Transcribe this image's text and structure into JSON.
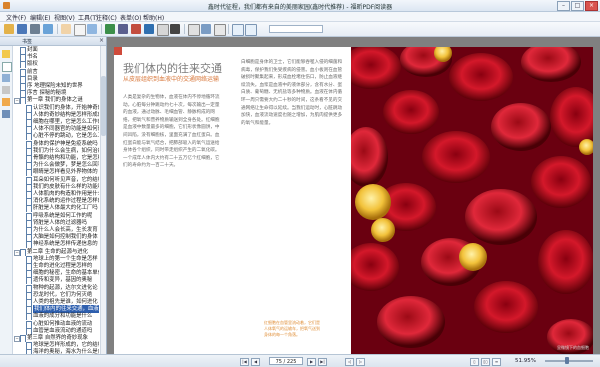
{
  "window": {
    "title": "鑫时代征程，我们都有来自的美丽家园(鑫时代推荐) - 福昕PDF阅读器",
    "minimize": "–",
    "maximize": "□",
    "close": "×"
  },
  "menu": [
    "文件(F)",
    "编辑(E)",
    "视图(V)",
    "工具(T)",
    "注释(C)",
    "表单(O)",
    "帮助(H)"
  ],
  "toolbar": {
    "search_placeholder": "",
    "icons": [
      "open-icon",
      "save-icon",
      "print-icon",
      "email-icon",
      "hand-icon",
      "select-icon",
      "zoom-icon",
      "snapshot-icon",
      "rotate-icon",
      "fit-page-icon",
      "fit-width-icon",
      "prev-view-icon",
      "next-view-icon",
      "bookmark-icon",
      "comment-icon"
    ]
  },
  "sidebar": {
    "header": "书签",
    "close": "×",
    "tabs": [
      "bookmarks-tab-icon",
      "pages-tab-icon",
      "layers-tab-icon",
      "attach-tab-icon",
      "comments-tab-icon",
      "sign-tab-icon"
    ],
    "items": [
      {
        "label": "封面",
        "level": 1,
        "expander": ""
      },
      {
        "label": "书名",
        "level": 1,
        "expander": ""
      },
      {
        "label": "版权",
        "level": 1,
        "expander": ""
      },
      {
        "label": "前言",
        "level": 1,
        "expander": ""
      },
      {
        "label": "目录",
        "level": 1,
        "expander": ""
      },
      {
        "label": "序 地理探险未知的世界",
        "level": 1,
        "expander": ""
      },
      {
        "label": "序言 探秘的秘境",
        "level": 1,
        "expander": ""
      },
      {
        "label": "第一章 我们的身体之谜",
        "level": 1,
        "expander": "−"
      },
      {
        "label": "认识我们的身体，开始神奇的旅程",
        "level": 2,
        "expander": ""
      },
      {
        "label": "人体的奇妙结构是怎样形成的",
        "level": 2,
        "expander": ""
      },
      {
        "label": "细胞在哪里，它是怎么工作的呢",
        "level": 2,
        "expander": ""
      },
      {
        "label": "人体不同器官的功能是如何形成的",
        "level": 2,
        "expander": ""
      },
      {
        "label": "心脏不停的跳动，它是怎么工作的",
        "level": 2,
        "expander": ""
      },
      {
        "label": "身体的保护神是免疫系统吗",
        "level": 2,
        "expander": ""
      },
      {
        "label": "我们为什么会生病，如何治疗",
        "level": 2,
        "expander": ""
      },
      {
        "label": "骨骼的结构和功能，它是怎样的",
        "level": 2,
        "expander": ""
      },
      {
        "label": "为什么会做梦，梦是怎么回事",
        "level": 2,
        "expander": ""
      },
      {
        "label": "眼睛是怎样看见外界物体的",
        "level": 2,
        "expander": ""
      },
      {
        "label": "耳朵如何听见声音，它的结构",
        "level": 2,
        "expander": ""
      },
      {
        "label": "我们的皮肤有什么样的功能呢",
        "level": 2,
        "expander": ""
      },
      {
        "label": "人体肌肉的构造和作用是什么",
        "level": 2,
        "expander": ""
      },
      {
        "label": "消化系统的运作过程是怎样的",
        "level": 2,
        "expander": ""
      },
      {
        "label": "肝脏是人体最大的化工厂吗",
        "level": 2,
        "expander": ""
      },
      {
        "label": "呼吸系统是如何工作的呢",
        "level": 2,
        "expander": ""
      },
      {
        "label": "肾脏是人体的过滤器吗",
        "level": 2,
        "expander": ""
      },
      {
        "label": "为什么人会长高，生长发育",
        "level": 2,
        "expander": ""
      },
      {
        "label": "大脑是如何控制我们的身体",
        "level": 2,
        "expander": ""
      },
      {
        "label": "神经系统是怎样传递信息的",
        "level": 2,
        "expander": ""
      },
      {
        "label": "第二章 生命的起源与进化",
        "level": 1,
        "expander": "−"
      },
      {
        "label": "地球上的第一个生命是怎样",
        "level": 2,
        "expander": ""
      },
      {
        "label": "生命的进化过程是怎样的",
        "level": 2,
        "expander": ""
      },
      {
        "label": "细胞的秘密，生命的基本单位",
        "level": 2,
        "expander": ""
      },
      {
        "label": "遗传和变异，基因的奥秘",
        "level": 2,
        "expander": ""
      },
      {
        "label": "物种的起源，达尔文进化论",
        "level": 2,
        "expander": ""
      },
      {
        "label": "恐龙时代，它们为何灭绝",
        "level": 2,
        "expander": ""
      },
      {
        "label": "人类的祖先是谁，如何进化",
        "level": 2,
        "expander": ""
      },
      {
        "label": "我们体内的往来交通，血液循环",
        "level": 2,
        "expander": "",
        "selected": true
      },
      {
        "label": "血液的成分和功能是什么",
        "level": 2,
        "expander": ""
      },
      {
        "label": "心脏如何推动血液的流动",
        "level": 2,
        "expander": ""
      },
      {
        "label": "血管是血液流动的通道吗",
        "level": 2,
        "expander": ""
      },
      {
        "label": "第三章 自然界的奇妙现象",
        "level": 1,
        "expander": "−"
      },
      {
        "label": "地球是怎样形成的，它的结构",
        "level": 2,
        "expander": ""
      },
      {
        "label": "海洋的奥秘，海水为什么是咸的",
        "level": 2,
        "expander": ""
      },
      {
        "label": "地震火山是怎么形成的",
        "level": 2,
        "expander": ""
      }
    ]
  },
  "document": {
    "title": "我们体内的往来交通",
    "subtitle": "从皮层组织到血液中的交通网络运输",
    "col1": "人类是复杂的生物体，血液在体内不停地循环流动。心脏每分钟跳动约七十次，每次输出一定量的血液，通过动脉、毛细血管、静脉构成的网络，把氧气和营养物质输送到全身各处。红细胞是血液中数量最多的细胞，它们形状像圆饼，中间凹陷，没有细胞核，里面充满了血红蛋白。血红蛋白能与氧气结合，把肺部吸入的氧气运送给身体各个组织，同时带走组织产生的二氧化碳。一个成年人体内大约有二十五万亿个红细胞，它们的寿命约为一百二十天。",
    "col2": "白细胞是身体的卫士，它们能够吞噬入侵的细菌和病毒，保护我们免受疾病的侵害。血小板则在血管破损时聚集起来，形成血栓堵住伤口，防止血液继续流失。血浆是血液中的液体部分，含有水分、蛋白质、葡萄糖、无机盐等多种物质。血液在体内循环一周只需要大约二十秒的时间，这条看不见的交通网络让生命得以延续。当我们运动时，心脏跳动加快，血液流动速度也随之增加，为肌肉提供更多的氧气和能量。",
    "callout": "红细胞在血管里流动着，它们是人体氧气的运输车，把氧气送到身体的每一个角落。",
    "right_page_label": "显微镜下的血细胞"
  },
  "status": {
    "page_input": "75 / 225",
    "zoom": "51.95%",
    "zoom_level": 0.45
  }
}
